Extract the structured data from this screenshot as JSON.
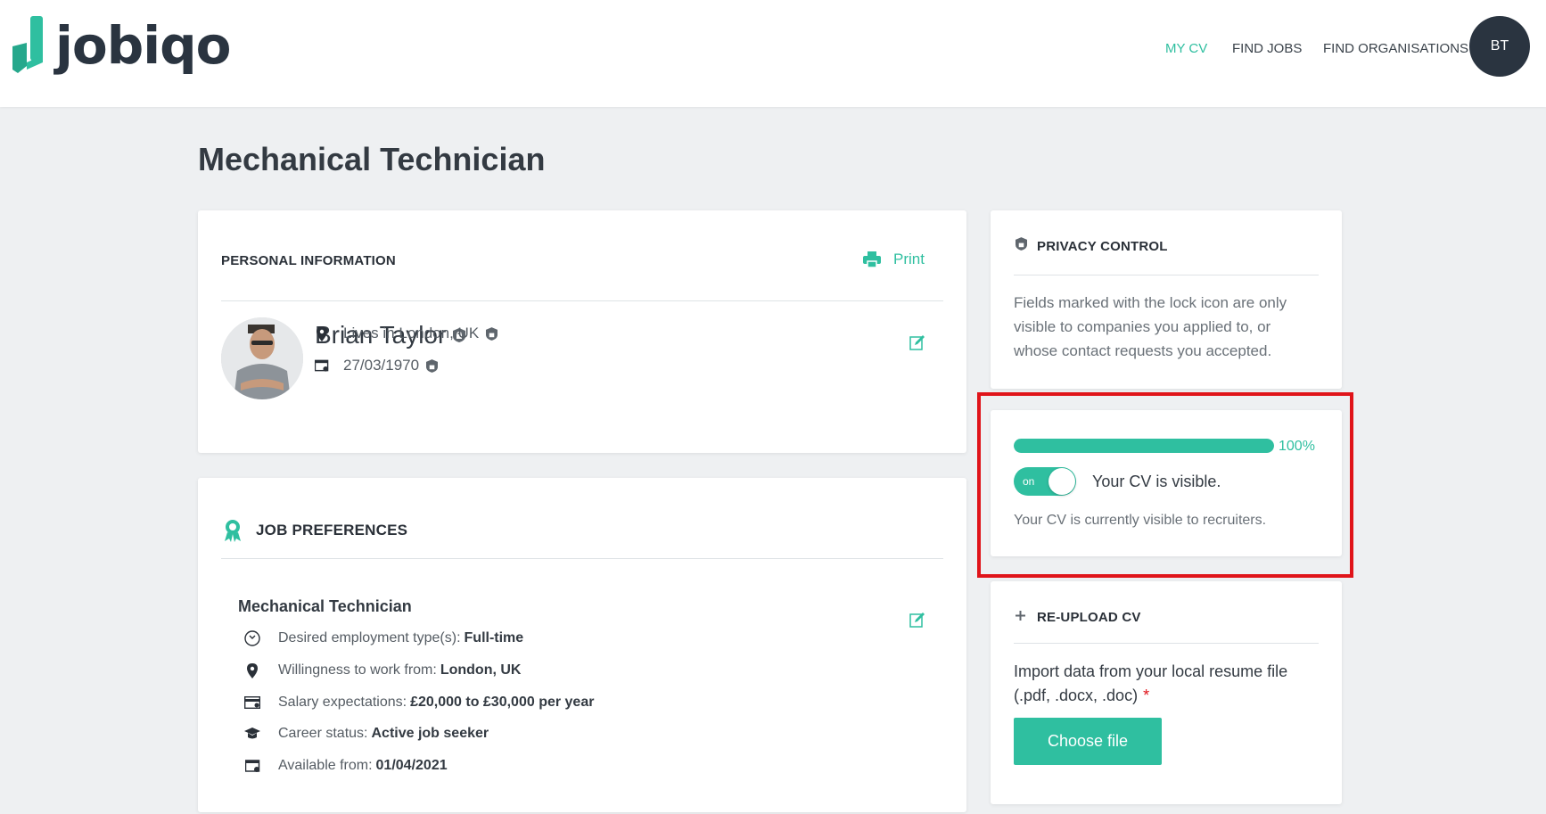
{
  "app": {
    "brand": "jobiqo",
    "brand_color": "#2fbfa0",
    "dark_color": "#2a3440"
  },
  "nav": {
    "items": [
      {
        "label": "MY CV",
        "active": true
      },
      {
        "label": "FIND JOBS",
        "active": false
      },
      {
        "label": "FIND ORGANISATIONS",
        "active": false
      }
    ],
    "user_initials": "BT"
  },
  "page": {
    "title": "Mechanical Technician"
  },
  "personal": {
    "heading": "PERSONAL INFORMATION",
    "print_label": "Print",
    "name": "Brian Taylor",
    "location": "Lives in London, UK",
    "birth_date": "27/03/1970"
  },
  "job_preferences": {
    "heading": "JOB PREFERENCES",
    "title": "Mechanical Technician",
    "rows": [
      {
        "icon": "clock-icon",
        "label": "Desired employment type(s):",
        "value": "Full-time"
      },
      {
        "icon": "location-pin-icon",
        "label": "Willingness to work from:",
        "value": "London, UK"
      },
      {
        "icon": "credit-card-icon",
        "label": "Salary expectations:",
        "value": "£20,000 to £30,000 per year"
      },
      {
        "icon": "graduation-cap-icon",
        "label": "Career status:",
        "value": "Active job seeker"
      },
      {
        "icon": "calendar-icon",
        "label": "Available from:",
        "value": "01/04/2021"
      }
    ]
  },
  "privacy": {
    "heading": "PRIVACY CONTROL",
    "text": "Fields marked with the lock icon are only visible to companies you applied to, or whose contact requests you accepted."
  },
  "visibility": {
    "progress_percent": 100,
    "progress_label": "100%",
    "toggle_state": "on",
    "toggle_label": "on",
    "status": "Your CV is visible.",
    "description": "Your CV is currently visible to recruiters."
  },
  "reupload": {
    "heading": "RE-UPLOAD CV",
    "text": "Import data from your local resume file (.pdf, .docx, .doc)",
    "required_mark": "*",
    "button_label": "Choose file"
  }
}
